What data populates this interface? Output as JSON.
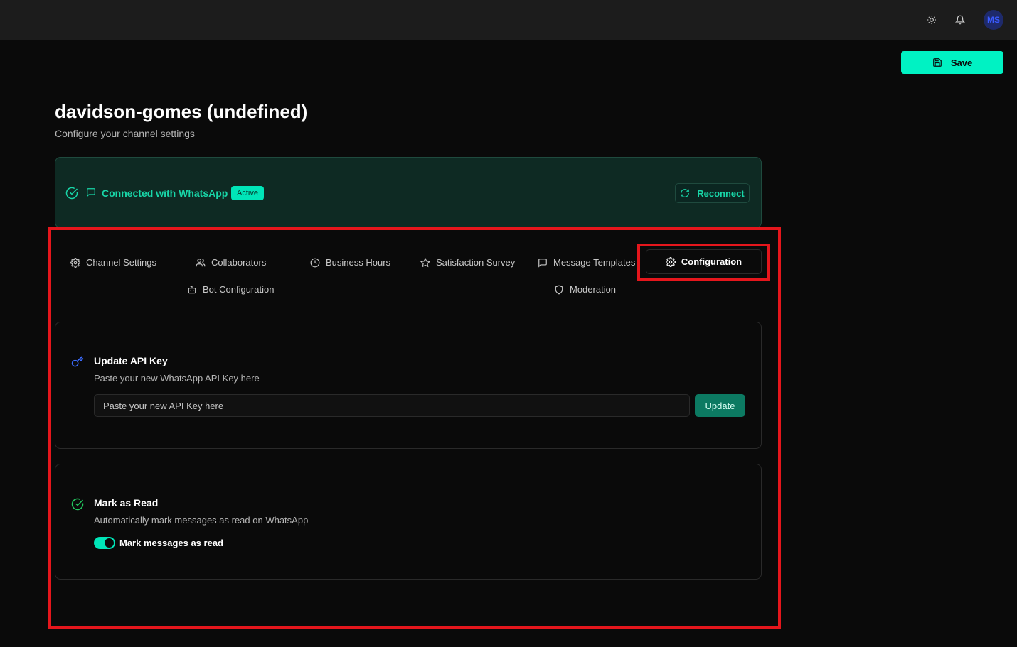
{
  "topbar": {
    "theme_icon": "sun-icon",
    "notifications_icon": "bell-icon",
    "avatar_initials": "MS"
  },
  "toolbar": {
    "save_label": "Save"
  },
  "page": {
    "title": "davidson-gomes (undefined)",
    "subtitle": "Configure your channel settings"
  },
  "connection": {
    "status_text": "Connected with WhatsApp",
    "badge": "Active",
    "reconnect_label": "Reconnect"
  },
  "tabs": [
    {
      "label": "Channel Settings",
      "icon": "gear-icon"
    },
    {
      "label": "Collaborators",
      "icon": "users-icon"
    },
    {
      "label": "Business Hours",
      "icon": "clock-icon"
    },
    {
      "label": "Satisfaction Survey",
      "icon": "star-icon"
    },
    {
      "label": "Message Templates",
      "icon": "message-icon"
    },
    {
      "label": "Configuration",
      "icon": "gear-icon",
      "active": true
    },
    {
      "label": "Bot Configuration",
      "icon": "bot-icon"
    },
    {
      "label": "Moderation",
      "icon": "shield-icon"
    }
  ],
  "api_key": {
    "title": "Update API Key",
    "description": "Paste your new WhatsApp API Key here",
    "placeholder": "Paste your new API Key here",
    "update_label": "Update"
  },
  "mark_read": {
    "title": "Mark as Read",
    "description": "Automatically mark messages as read on WhatsApp",
    "toggle_label": "Mark messages as read",
    "enabled": true
  },
  "colors": {
    "accent": "#00f2c3",
    "success": "#18d6a8",
    "highlight": "#e5161c"
  }
}
